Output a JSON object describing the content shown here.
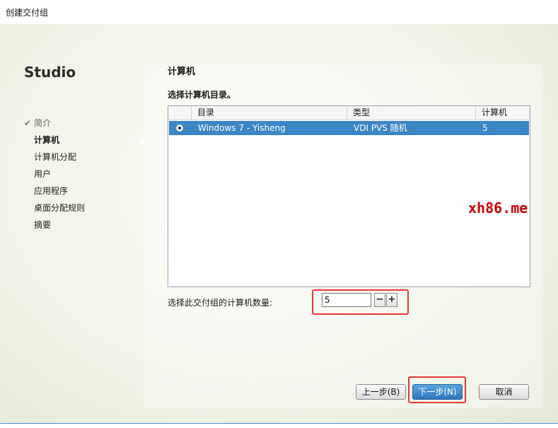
{
  "window": {
    "title": "创建交付组"
  },
  "sidebar": {
    "brand": "Studio",
    "steps": [
      {
        "label": "简介",
        "state": "done"
      },
      {
        "label": "计算机",
        "state": "active"
      },
      {
        "label": "计算机分配",
        "state": "pending"
      },
      {
        "label": "用户",
        "state": "pending"
      },
      {
        "label": "应用程序",
        "state": "pending"
      },
      {
        "label": "桌面分配规则",
        "state": "pending"
      },
      {
        "label": "摘要",
        "state": "pending"
      }
    ]
  },
  "main": {
    "title": "计算机",
    "subtitle": "选择计算机目录。",
    "table": {
      "columns": [
        "目录",
        "类型",
        "计算机"
      ],
      "rows": [
        {
          "selected": true,
          "catalog": "Windows 7 - Yisheng",
          "type": "VDI PVS 随机",
          "count": "5"
        }
      ]
    },
    "count_label": "选择此交付组的计算机数量:",
    "count_value": "5",
    "stepper": {
      "minus": "−",
      "plus": "+"
    }
  },
  "buttons": {
    "back": "上一步(B)",
    "next": "下一步(N)",
    "cancel": "取消"
  },
  "watermark": "xh86.me",
  "colors": {
    "selection": "#3d86c6",
    "highlight": "#e53935",
    "watermark": "#cc0000"
  }
}
